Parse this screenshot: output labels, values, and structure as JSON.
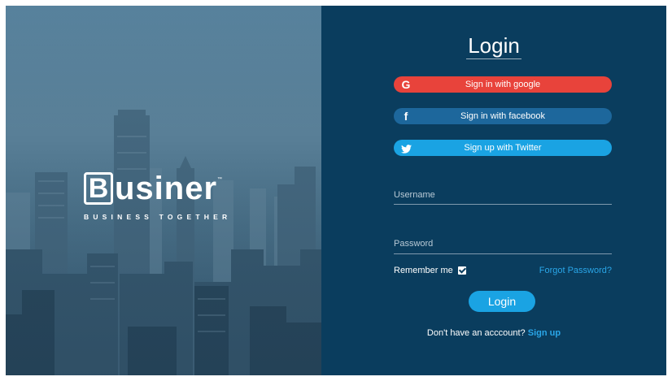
{
  "brand": {
    "logo_initial": "B",
    "logo_rest": "usiner",
    "tagline": "BUSINESS TOGETHER"
  },
  "login": {
    "title": "Login",
    "social": [
      {
        "icon": "google-icon",
        "icon_glyph": "G",
        "label": "Sign in with google",
        "color": "#e8433b"
      },
      {
        "icon": "facebook-icon",
        "icon_glyph": "f",
        "label": "Sign in with facebook",
        "color": "#1d679c"
      },
      {
        "icon": "twitter-icon",
        "icon_glyph": "🐦",
        "label": "Sign up with Twitter",
        "color": "#1aa3e3"
      }
    ],
    "username_placeholder": "Username",
    "password_placeholder": "Password",
    "remember_label": "Remember me",
    "remember_checked": true,
    "forgot_label": "Forgot Password?",
    "submit_label": "Login",
    "no_account_text": "Don't have an acccount?",
    "signup_label": "Sign up"
  },
  "colors": {
    "panel_bg": "#0a3d5e",
    "accent": "#1aa3e3",
    "link": "#2aa6e8"
  }
}
